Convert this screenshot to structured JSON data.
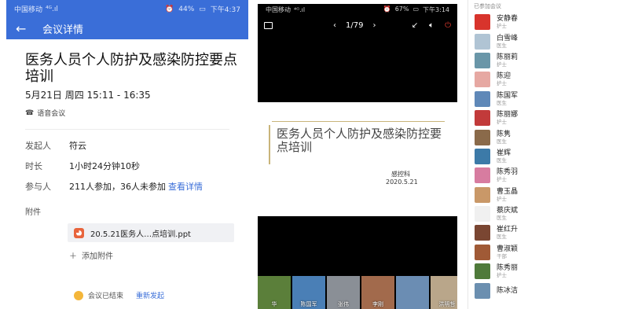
{
  "panel1": {
    "status": {
      "carrier": "中国移动",
      "signal": "⁴ᴳ.ıl",
      "battery": "44%",
      "time": "下午4:37"
    },
    "back_icon": "←",
    "header_title": "会议详情",
    "meeting_title": "医务人员个人防护及感染防控要点培训",
    "meeting_time": "5月21日 周四 15:11 - 16:35",
    "meeting_type": "语音会议",
    "organizer_label": "发起人",
    "organizer": "符云",
    "duration_label": "时长",
    "duration": "1小时24分钟10秒",
    "participants_label": "参与人",
    "participants": "211人参加，36人未参加",
    "participants_link": "查看详情",
    "attachment_label": "附件",
    "attachment_name": "20.5.21医务人…点培训.ppt",
    "add_attachment": "添加附件",
    "footer_status": "会议已结束",
    "footer_action": "重新发起"
  },
  "panel2": {
    "status": {
      "carrier": "中国移动",
      "signal": "⁴ᴳ.ıl",
      "battery": "67%",
      "time": "下午3:14"
    },
    "page_indicator": "1/79",
    "slide": {
      "title": "医务人员个人防护及感染防控要点培训",
      "org": "感控科",
      "date": "2020.5.21"
    },
    "thumbnails": [
      {
        "name": "华",
        "color": "#5b7f3a"
      },
      {
        "name": "陈国军",
        "color": "#4a7fb6"
      },
      {
        "name": "张伟",
        "color": "#8a8f96"
      },
      {
        "name": "李刚",
        "color": "#a26a4c"
      },
      {
        "name": "",
        "color": "#6b8db3"
      },
      {
        "name": "洪明哲",
        "color": "#b9a68a"
      },
      {
        "name": "南雪峰",
        "color": "#7d6b55"
      }
    ]
  },
  "panel3": {
    "header": "已参加会议",
    "people": [
      {
        "name": "安静春",
        "role": "护士",
        "color": "#d8342c"
      },
      {
        "name": "白雪峰",
        "role": "医生",
        "color": "#b0c4d4"
      },
      {
        "name": "陈丽莉",
        "role": "护士",
        "color": "#6a96a8"
      },
      {
        "name": "陈迎",
        "role": "护士",
        "color": "#e6a8a2"
      },
      {
        "name": "陈国军",
        "role": "医生",
        "color": "#5f88b8"
      },
      {
        "name": "陈丽娜",
        "role": "护士",
        "color": "#c23a3a"
      },
      {
        "name": "陈隽",
        "role": "医生",
        "color": "#8a6a4a"
      },
      {
        "name": "崔辉",
        "role": "医生",
        "color": "#3c7aa8"
      },
      {
        "name": "陈秀羽",
        "role": "护士",
        "color": "#d77ca0"
      },
      {
        "name": "曹玉晶",
        "role": "护士",
        "color": "#c99868"
      },
      {
        "name": "蔡庆斌",
        "role": "医生",
        "color": "#f0f0f0"
      },
      {
        "name": "崔红升",
        "role": "医生",
        "color": "#7a4632"
      },
      {
        "name": "曹淑颖",
        "role": "干部",
        "color": "#a05a36"
      },
      {
        "name": "陈秀丽",
        "role": "护士",
        "color": "#4f7a3a"
      },
      {
        "name": "陈冰洁",
        "role": "",
        "color": "#6b8fb0"
      }
    ]
  }
}
